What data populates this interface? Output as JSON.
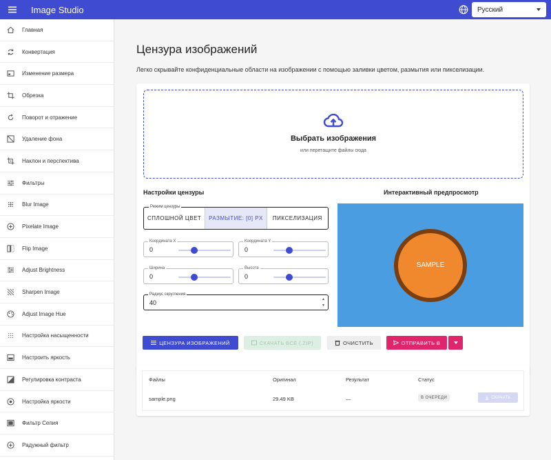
{
  "app": {
    "title": "Image Studio",
    "language": "Русский"
  },
  "sidebar": {
    "items": [
      {
        "label": "Главная",
        "icon": "home-icon"
      },
      {
        "label": "Конвертация",
        "icon": "sync-icon"
      },
      {
        "label": "Изменение размера",
        "icon": "resize-icon"
      },
      {
        "label": "Обрезка",
        "icon": "crop-icon"
      },
      {
        "label": "Поворот и отражение",
        "icon": "rotate-icon"
      },
      {
        "label": "Удаление фона",
        "icon": "remove-bg-icon"
      },
      {
        "label": "Наклон и перспектива",
        "icon": "perspective-icon"
      },
      {
        "label": "Фильтры",
        "icon": "tune-icon"
      },
      {
        "label": "Blur Image",
        "icon": "blur-icon"
      },
      {
        "label": "Pixelate Image",
        "icon": "pixelate-icon"
      },
      {
        "label": "Flip Image",
        "icon": "flip-icon"
      },
      {
        "label": "Adjust Brightness",
        "icon": "brightness-icon"
      },
      {
        "label": "Sharpen Image",
        "icon": "sharpen-icon"
      },
      {
        "label": "Adjust Image Hue",
        "icon": "palette-icon"
      },
      {
        "label": "Настройка насыщенности",
        "icon": "saturation-icon"
      },
      {
        "label": "Настроить яркость",
        "icon": "image-icon"
      },
      {
        "label": "Регулировка контраста",
        "icon": "contrast-icon"
      },
      {
        "label": "Настройка яркости",
        "icon": "exposure-icon"
      },
      {
        "label": "Фильтр Сепия",
        "icon": "sepia-icon"
      },
      {
        "label": "Радужный фильтр",
        "icon": "plus-circle-icon"
      }
    ]
  },
  "page": {
    "title": "Цензура изображений",
    "subtitle": "Легко скрывайте конфиденциальные области на изображении с помощью заливки цветом, размытия или пикселизации."
  },
  "dropzone": {
    "title": "Выбрать изображения",
    "subtitle": "или перетащите файлы сюда"
  },
  "settings": {
    "title": "Настройки цензуры",
    "mode_legend": "Режим цензуры",
    "modes": [
      "СПЛОШНОЙ ЦВЕТ",
      "РАЗМЫТИЕ: [0] PX",
      "ПИКСЕЛИЗАЦИЯ"
    ],
    "active_mode": 1,
    "x": {
      "label": "Координата X",
      "value": "0",
      "slider_fraction": 0.3
    },
    "y": {
      "label": "Координата Y",
      "value": "0",
      "slider_fraction": 0.3
    },
    "width": {
      "label": "Ширина",
      "value": "0",
      "slider_fraction": 0.3
    },
    "height": {
      "label": "Высота",
      "value": "0",
      "slider_fraction": 0.3
    },
    "radius": {
      "label": "Радиус скругления",
      "value": "40"
    }
  },
  "preview": {
    "title": "Интерактивный предпросмотр",
    "sample_label": "SAMPLE",
    "bg_color": "#4a9de0",
    "circle_color": "#f0892e",
    "ring_color": "#7a3e10"
  },
  "actions": {
    "censor": "ЦЕНЗУРА ИЗОБРАЖЕНИЙ",
    "download_all": "СКАЧАТЬ ВСЁ (.ZIP)",
    "clear": "ОЧИСТИТЬ",
    "send_to": "ОТПРАВИТЬ В"
  },
  "files": {
    "headers": {
      "files": "Файлы",
      "original": "Оригинал",
      "result": "Результат",
      "status": "Статус"
    },
    "rows": [
      {
        "name": "sample.png",
        "original": "29.49 KB",
        "result": "—",
        "status": "В ОЧЕРЕДИ",
        "download": "СКАЧАТЬ"
      }
    ]
  },
  "colors": {
    "primary": "#3f4bd0",
    "accent": "#e0266b"
  }
}
